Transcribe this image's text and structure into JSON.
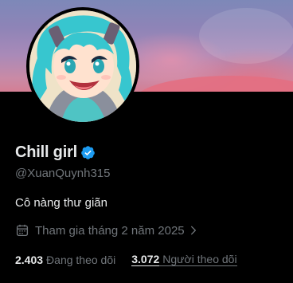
{
  "profile": {
    "display_name": "Chill girl",
    "handle": "@XuanQuynh315",
    "bio": "Cô nàng thư giãn",
    "joined": "Tham gia tháng 2 năm 2025",
    "following_count": "2.403",
    "following_label": "Đang theo dõi",
    "followers_count": "3.072",
    "followers_label": "Người theo dõi"
  },
  "colors": {
    "verified": "#1d9bf0",
    "muted": "#71767b",
    "text": "#e7e9ea",
    "background": "#000000"
  },
  "icons": {
    "verified": "verified-badge-icon",
    "calendar": "calendar-icon",
    "chevron": "chevron-right-icon"
  }
}
